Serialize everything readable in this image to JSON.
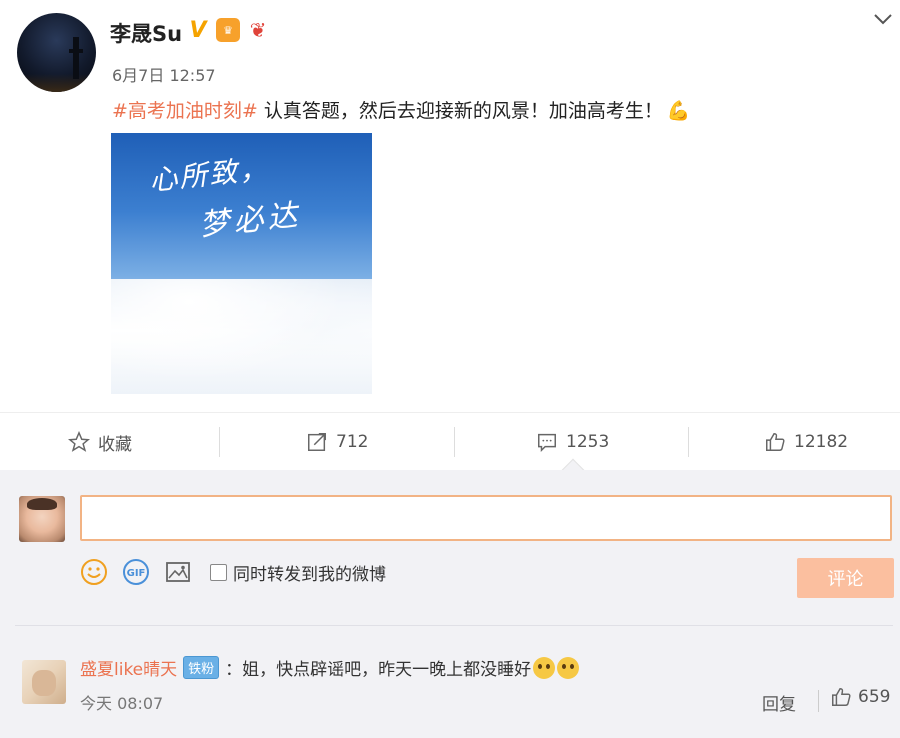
{
  "post": {
    "username": "李晟Su",
    "timestamp": "6月7日 12:57",
    "hashtag": "#高考加油时刻#",
    "text": " 认真答题，然后去迎接新的风景！加油高考生！",
    "emoji": "💪",
    "image_line1": "心所致，",
    "image_line2": "梦必达",
    "badges": [
      "verified-v-icon",
      "vip-icon",
      "bow-icon"
    ]
  },
  "actions": {
    "favorite_label": "收藏",
    "repost_count": "712",
    "comment_count": "1253",
    "like_count": "12182"
  },
  "composer": {
    "input_value": "",
    "share_label": "同时转发到我的微博",
    "submit_label": "评论"
  },
  "comments": [
    {
      "user": "盛夏like晴天",
      "fan_badge": "铁粉",
      "text": "：姐，快点辟谣吧，昨天一晚上都没睡好",
      "time": "今天 08:07",
      "reply_label": "回复",
      "like_count": "659"
    }
  ],
  "colors": {
    "accent": "#eb7350",
    "input_border": "#f2b384",
    "submit_bg": "#fbbf9f",
    "panel_bg": "#f2f2f5"
  }
}
